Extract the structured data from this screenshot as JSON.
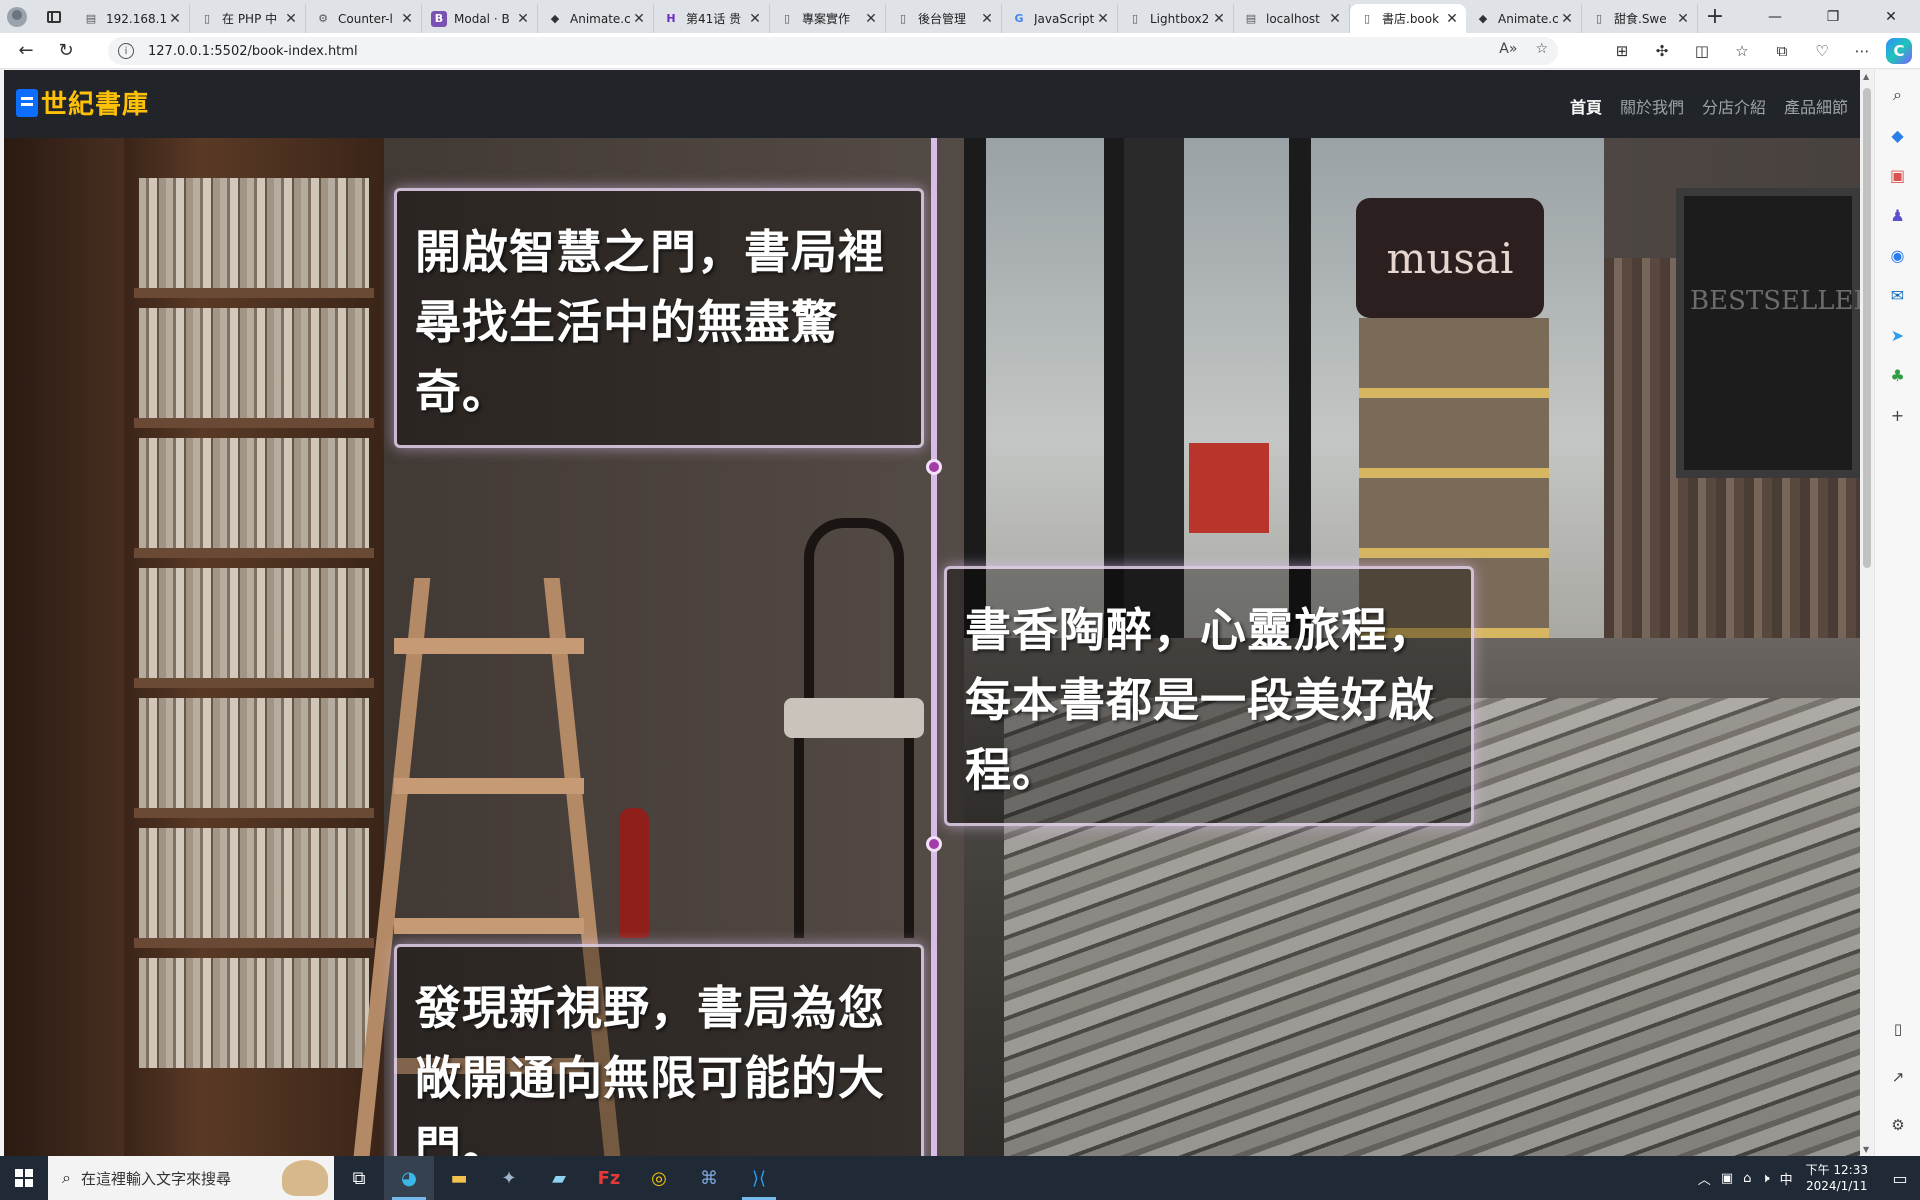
{
  "browser": {
    "tabs": [
      {
        "title": "192.168.1",
        "favicon": "page-icon",
        "active": false
      },
      {
        "title": "在 PHP 中",
        "favicon": "document-icon",
        "active": false
      },
      {
        "title": "Counter-l",
        "favicon": "gear-icon",
        "active": false
      },
      {
        "title": "Modal · B",
        "favicon": "bootstrap-icon",
        "active": false
      },
      {
        "title": "Animate.c",
        "favicon": "diamond-icon",
        "active": false
      },
      {
        "title": "第41话 贵",
        "favicon": "h-icon",
        "active": false
      },
      {
        "title": "專案實作",
        "favicon": "document-icon",
        "active": false
      },
      {
        "title": "後台管理",
        "favicon": "document-icon",
        "active": false
      },
      {
        "title": "JavaScript",
        "favicon": "google-icon",
        "active": false
      },
      {
        "title": "Lightbox2",
        "favicon": "document-icon",
        "active": false
      },
      {
        "title": "localhost",
        "favicon": "page-icon",
        "active": false
      },
      {
        "title": "書店.book",
        "favicon": "document-icon",
        "active": true
      },
      {
        "title": "Animate.c",
        "favicon": "diamond-icon",
        "active": false
      },
      {
        "title": "甜食.Swe",
        "favicon": "document-icon",
        "active": false
      }
    ],
    "new_tab_label": "+",
    "url": "127.0.0.1:5502/book-index.html",
    "window_controls": {
      "minimize": "—",
      "restore": "❐",
      "close": "✕"
    }
  },
  "site": {
    "brand": "世紀書庫",
    "nav": [
      {
        "label": "首頁",
        "active": true
      },
      {
        "label": "關於我們",
        "active": false
      },
      {
        "label": "分店介紹",
        "active": false
      },
      {
        "label": "產品細節",
        "active": false
      }
    ],
    "timeline": [
      {
        "text": "開啟智慧之門，書局裡尋找生活中的無盡驚奇。"
      },
      {
        "text": "書香陶醉，心靈旅程，每本書都是一段美好啟程。"
      },
      {
        "text": "發現新視野，書局為您敞開通向無限可能的大門。"
      }
    ],
    "scene_text": {
      "shop_sign": "musai",
      "board": "BESTSELLER"
    },
    "colors": {
      "brand": "#ffc107",
      "brand_icon": "#0d6efd",
      "nav_bg": "#212529",
      "timeline_line": "#d8bde8",
      "timeline_dot": "#a43ca8"
    }
  },
  "taskbar": {
    "search_placeholder": "在這裡輸入文字來搜尋",
    "tray_ime": "中",
    "clock_time": "下午 12:33",
    "clock_date": "2024/1/11"
  }
}
